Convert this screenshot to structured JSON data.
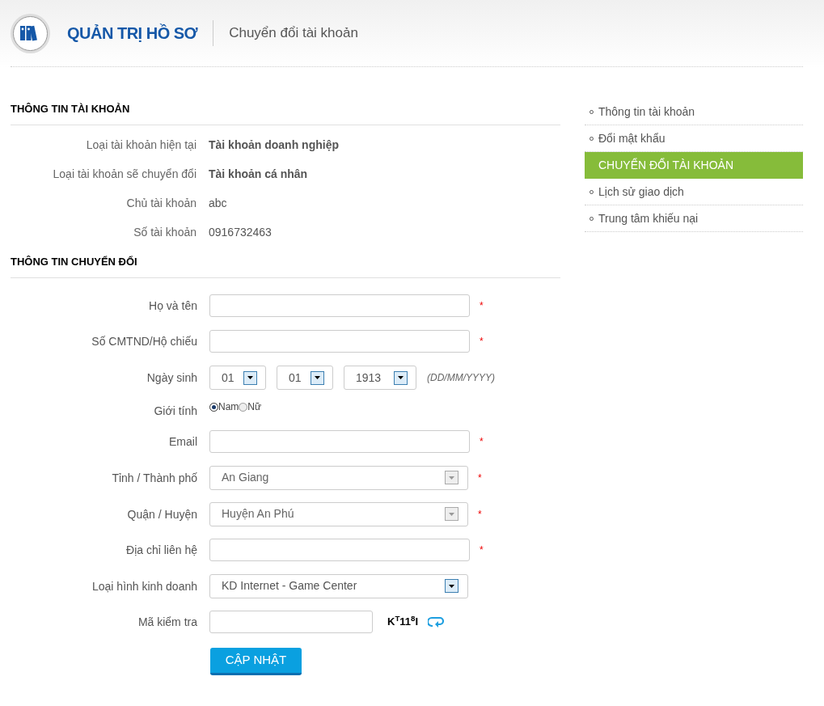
{
  "header": {
    "title": "QUẢN TRỊ HỒ SƠ",
    "subtitle": "Chuyển đổi tài khoản"
  },
  "account_section": {
    "heading": "THÔNG TIN TÀI KHOẢN",
    "rows": [
      {
        "label": "Loại tài khoản hiện tại",
        "value": "Tài khoản doanh nghiệp",
        "bold": true
      },
      {
        "label": "Loại tài khoản sẽ chuyển đổi",
        "value": "Tài khoản cá nhân",
        "bold": true
      },
      {
        "label": "Chủ tài khoản",
        "value": "abc",
        "bold": false
      },
      {
        "label": "Số tài khoản",
        "value": "0916732463",
        "bold": false
      }
    ]
  },
  "form_section": {
    "heading": "THÔNG TIN CHUYỂN ĐỔI",
    "fields": [
      {
        "kind": "text",
        "label": "Họ và tên",
        "required_mark": "*"
      },
      {
        "kind": "text",
        "label": "Số CMTND/Hộ chiếu",
        "required_mark": "*"
      },
      {
        "kind": "date",
        "label": "Ngày sinh",
        "parts": [
          "01",
          "01",
          "1913"
        ],
        "hint": "(DD/MM/YYYY)"
      },
      {
        "kind": "radio",
        "label": "Giới tính",
        "options": [
          {
            "label": "Nam",
            "selected": true
          },
          {
            "label": "Nữ",
            "selected": false
          }
        ]
      },
      {
        "kind": "text",
        "label": "Email",
        "required_mark": "*"
      },
      {
        "kind": "select",
        "label": "Tỉnh / Thành phố",
        "value": "An Giang",
        "disabled": true,
        "required_mark": "*"
      },
      {
        "kind": "select",
        "label": "Quận / Huyện",
        "value": "Huyện An Phú",
        "disabled": true,
        "required_mark": "*"
      },
      {
        "kind": "text",
        "label": "Địa chỉ liên hệ",
        "required_mark": "*"
      },
      {
        "kind": "select",
        "label": "Loại hình kinh doanh",
        "value": "KD Internet - Game Center",
        "disabled": false
      },
      {
        "kind": "captcha",
        "label": "Mã kiểm tra",
        "code": "K$^{T}$11$^{8}$I"
      }
    ],
    "submit": "CẬP NHẬT"
  },
  "sidebar": {
    "items": [
      {
        "label": "Thông tin tài khoản",
        "selected": false
      },
      {
        "label": "Đổi mật khẩu",
        "selected": false
      },
      {
        "label": "CHUYỂN ĐỔI TÀI KHOẢN",
        "selected": true
      },
      {
        "label": "Lịch sử giao dịch",
        "selected": false
      },
      {
        "label": "Trung tâm khiếu nại",
        "selected": false
      }
    ]
  }
}
